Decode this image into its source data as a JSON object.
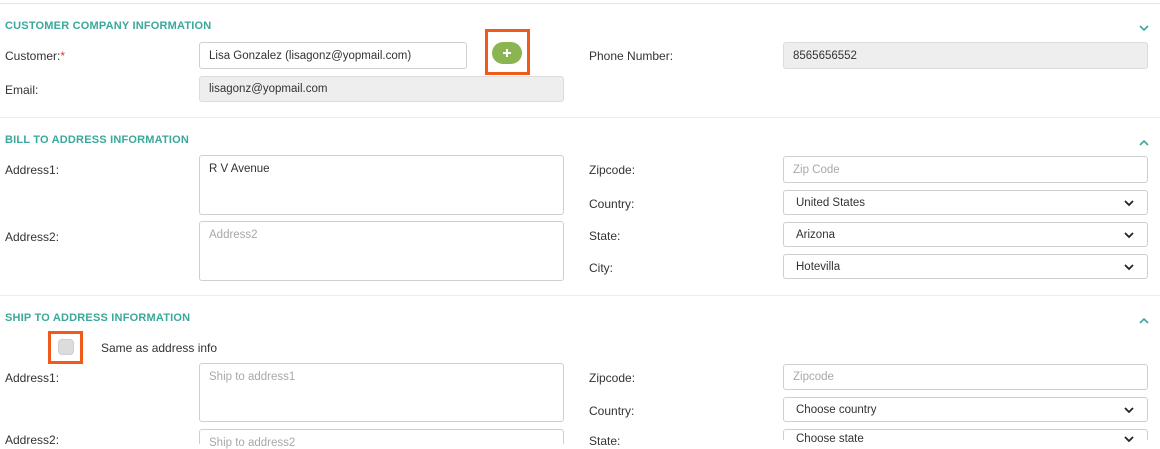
{
  "customer_section": {
    "title": "CUSTOMER COMPANY INFORMATION",
    "customer_label": "Customer:",
    "required_mark": "*",
    "customer_value": "Lisa Gonzalez (lisagonz@yopmail.com)",
    "phone_label": "Phone Number:",
    "phone_value": "8565656552",
    "email_label": "Email:",
    "email_value": "lisagonz@yopmail.com"
  },
  "bill_section": {
    "title": "BILL TO ADDRESS INFORMATION",
    "address1_label": "Address1:",
    "address1_value": "R V Avenue",
    "address2_label": "Address2:",
    "address2_placeholder": "Address2",
    "zipcode_label": "Zipcode:",
    "zipcode_placeholder": "Zip Code",
    "country_label": "Country:",
    "country_value": "United States",
    "state_label": "State:",
    "state_value": "Arizona",
    "city_label": "City:",
    "city_value": "Hotevilla"
  },
  "ship_section": {
    "title": "SHIP TO ADDRESS INFORMATION",
    "same_as_label": "Same as address info",
    "address1_label": "Address1:",
    "address1_placeholder": "Ship to address1",
    "address2_label": "Address2:",
    "address2_placeholder": "Ship to address2",
    "zipcode_label": "Zipcode:",
    "zipcode_placeholder": "Zipcode",
    "country_label": "Country:",
    "country_value": "Choose country",
    "state_label": "State:",
    "state_value": "Choose state"
  },
  "colors": {
    "accent": "#3aa89a",
    "highlight": "#f05a1a",
    "add_button": "#8bb550",
    "required": "#e53935"
  },
  "icons": {
    "customer_collapse": "chevron-down-icon",
    "bill_collapse": "chevron-up-icon",
    "ship_collapse": "chevron-up-icon",
    "add_customer": "plus-icon",
    "select_caret": "chevron-down-icon"
  }
}
